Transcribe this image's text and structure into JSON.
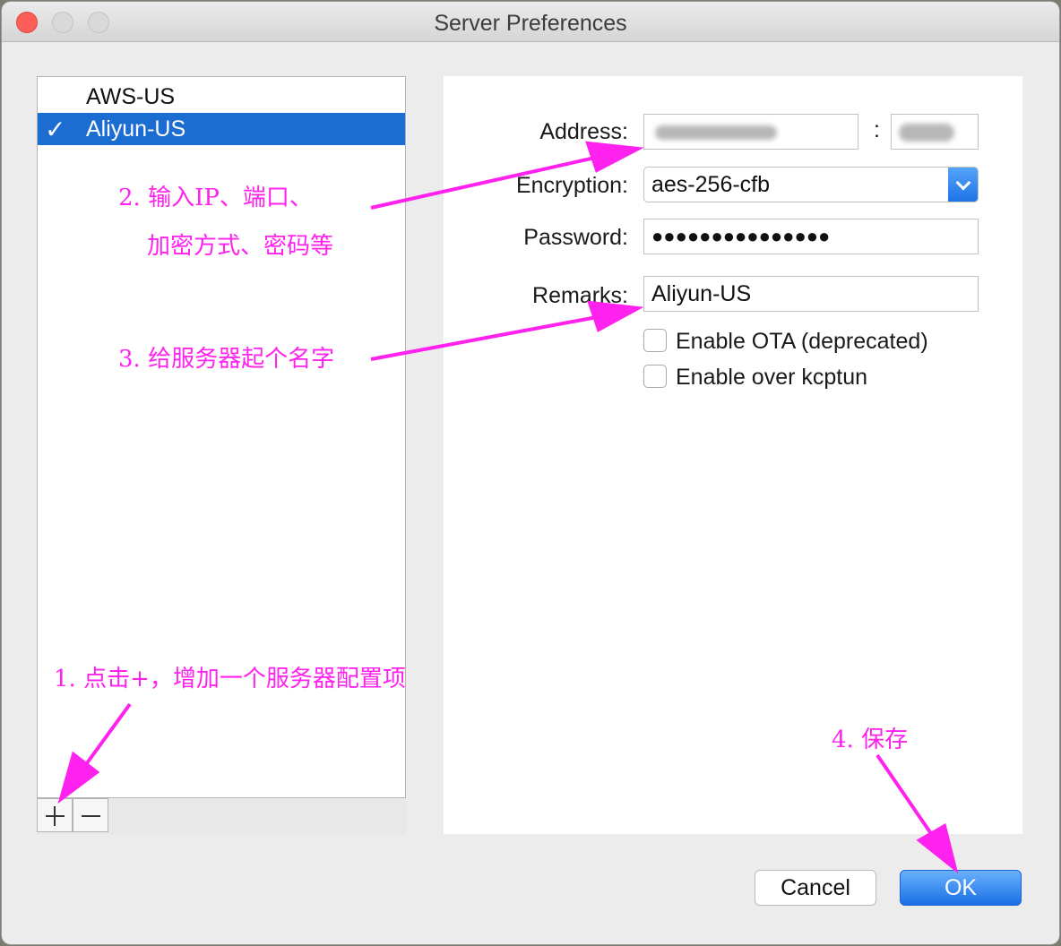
{
  "window": {
    "title": "Server Preferences"
  },
  "servers": [
    {
      "name": "AWS-US",
      "selected": false
    },
    {
      "name": "Aliyun-US",
      "selected": true
    }
  ],
  "list_controls": {
    "add_icon": "plus-icon",
    "remove_icon": "minus-icon"
  },
  "form": {
    "address_label": "Address:",
    "port_colon": ":",
    "encryption_label": "Encryption:",
    "encryption_value": "aes-256-cfb",
    "password_label": "Password:",
    "password_value": "●●●●●●●●●●●●●●●",
    "remarks_label": "Remarks:",
    "remarks_value": "Aliyun-US",
    "enable_ota_label": "Enable OTA (deprecated)",
    "enable_ota_checked": false,
    "enable_kcptun_label": "Enable over kcptun",
    "enable_kcptun_checked": false
  },
  "buttons": {
    "cancel": "Cancel",
    "ok": "OK"
  },
  "annotations": {
    "step1": "1. 点击+，增加一个服务器配置项",
    "step2_line1": "2. 输入IP、端口、",
    "step2_line2": "加密方式、密码等",
    "step3": "3. 给服务器起个名字",
    "step4": "4. 保存"
  },
  "colors": {
    "selection": "#1c6dd2",
    "annotation": "#ff22ee",
    "primary_button": "#1b6fe5"
  }
}
